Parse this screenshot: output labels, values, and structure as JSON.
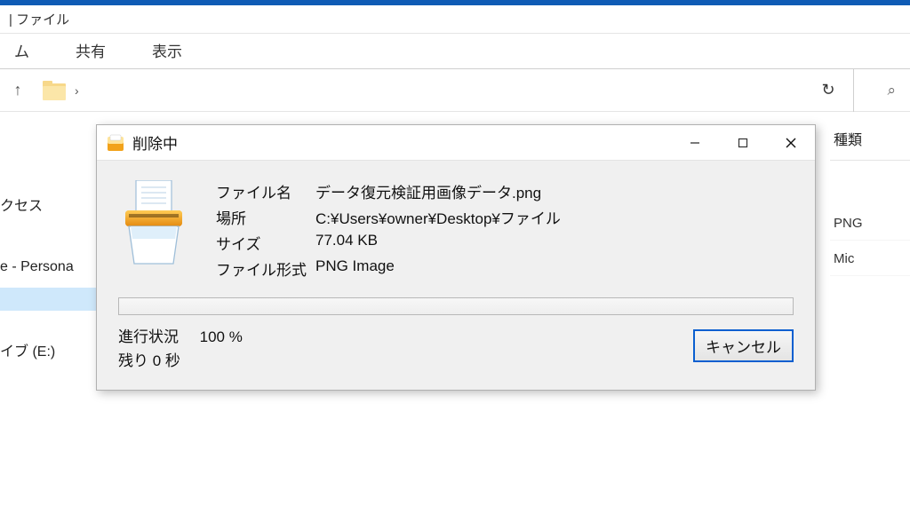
{
  "explorer": {
    "title_fragment": "|  ファイル",
    "tabs": {
      "home": "ム",
      "share": "共有",
      "view": "表示"
    },
    "sidebar": {
      "item_quick": "クセス",
      "item_personal": "e - Persona",
      "item_drive": "イブ (E:)"
    },
    "right_column": {
      "header": "種類",
      "row1": "PNG",
      "row2": "Mic"
    }
  },
  "dialog": {
    "title": "削除中",
    "fields": {
      "filename_label": "ファイル名",
      "filename_value": "データ復元検証用画像データ.png",
      "location_label": "場所",
      "location_value": "C:¥Users¥owner¥Desktop¥ファイル",
      "size_label": "サイズ",
      "size_value": "77.04 KB",
      "type_label": "ファイル形式",
      "type_value": "PNG Image"
    },
    "status": {
      "progress_label": "進行状況",
      "progress_value": "100 %",
      "remaining": "残り 0 秒"
    },
    "cancel_label": "キャンセル"
  }
}
